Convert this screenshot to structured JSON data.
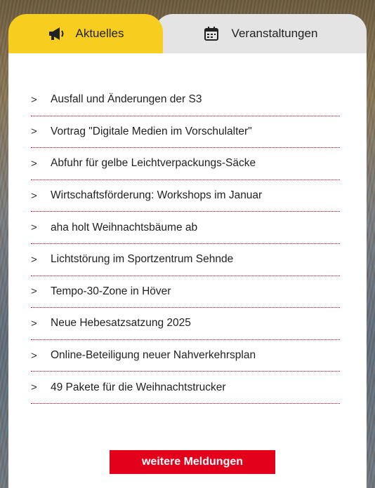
{
  "tabs": [
    {
      "label": "Aktuelles",
      "icon": "megaphone-icon",
      "active": true,
      "color": "#f7ce1f"
    },
    {
      "label": "Veranstaltungen",
      "icon": "calendar-icon",
      "active": false,
      "color": "#e4e4e4"
    }
  ],
  "news": [
    "Ausfall und Änderungen der S3",
    "Vortrag \"Digitale Medien im Vorschulalter\"",
    "Abfuhr für gelbe Leichtverpackungs-Säcke",
    "Wirtschaftsförderung: Workshops im Januar",
    "aha holt Weihnachtsbäume ab",
    "Lichtstörung im Sportzentrum Sehnde",
    "Tempo-30-Zone in Höver",
    "Neue Hebesatzsatzung 2025",
    "Online-Beteiligung neuer Nahverkehrsplan",
    "49 Pakete für die Weihnachtstrucker"
  ],
  "more_button": {
    "label": "weitere Meldungen",
    "color": "#e2001a"
  },
  "chevron": ">"
}
